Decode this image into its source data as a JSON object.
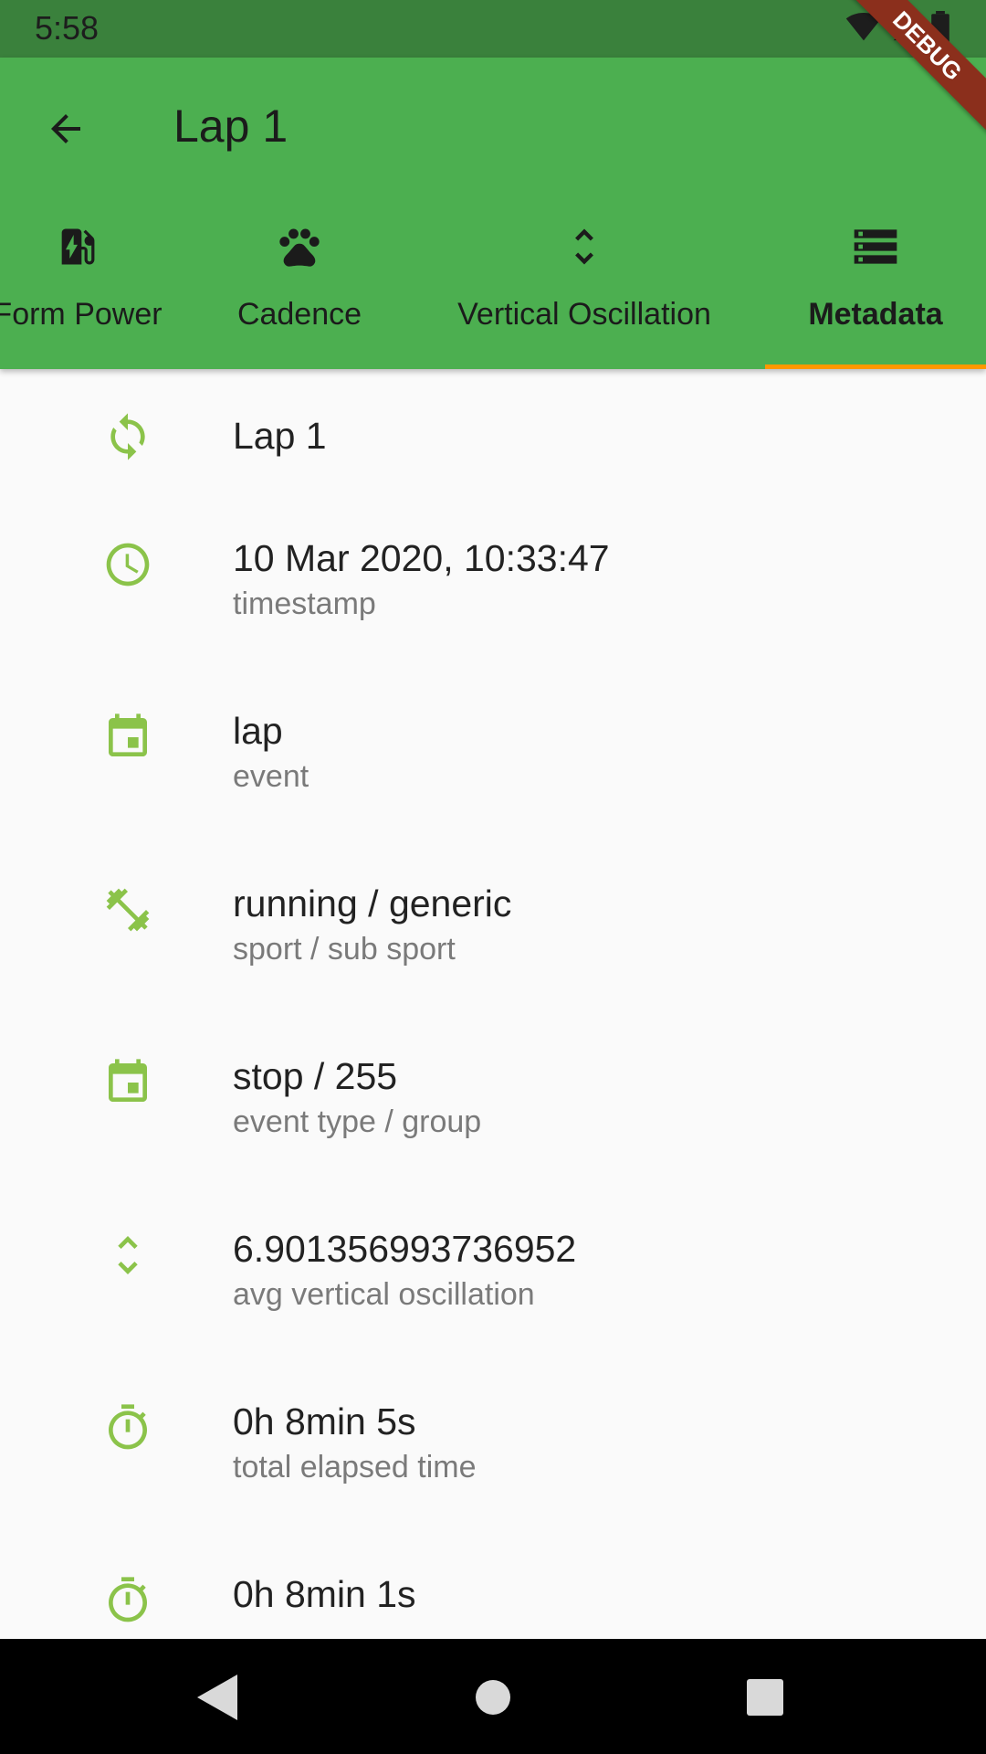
{
  "status_bar": {
    "time": "5:58"
  },
  "app_bar": {
    "title": "Lap 1"
  },
  "tabs": [
    {
      "label": "Form Power",
      "icon": "ev-station-icon"
    },
    {
      "label": "Cadence",
      "icon": "paw-icon"
    },
    {
      "label": "Vertical Oscillation",
      "icon": "unfold-more-icon"
    },
    {
      "label": "Metadata",
      "icon": "storage-icon",
      "selected": true
    }
  ],
  "rows": [
    {
      "icon": "refresh-icon",
      "value": "Lap 1",
      "label": ""
    },
    {
      "icon": "clock-icon",
      "value": "10 Mar 2020, 10:33:47",
      "label": "timestamp"
    },
    {
      "icon": "event-icon",
      "value": "lap",
      "label": "event"
    },
    {
      "icon": "fitness-icon",
      "value": "running / generic",
      "label": "sport / sub sport"
    },
    {
      "icon": "event-icon",
      "value": "stop / 255",
      "label": "event type / group"
    },
    {
      "icon": "unfold-more-icon",
      "value": "6.901356993736952",
      "label": "avg vertical oscillation"
    },
    {
      "icon": "timer-icon",
      "value": "0h 8min 5s",
      "label": "total elapsed time"
    },
    {
      "icon": "timer-icon",
      "value": "0h 8min 1s",
      "label": ""
    }
  ],
  "debug_banner": "DEBUG",
  "colors": {
    "app_bar": "#4caf50",
    "status_bar": "#3a813c",
    "accent": "#8bc34a",
    "indicator": "#ff9800"
  }
}
